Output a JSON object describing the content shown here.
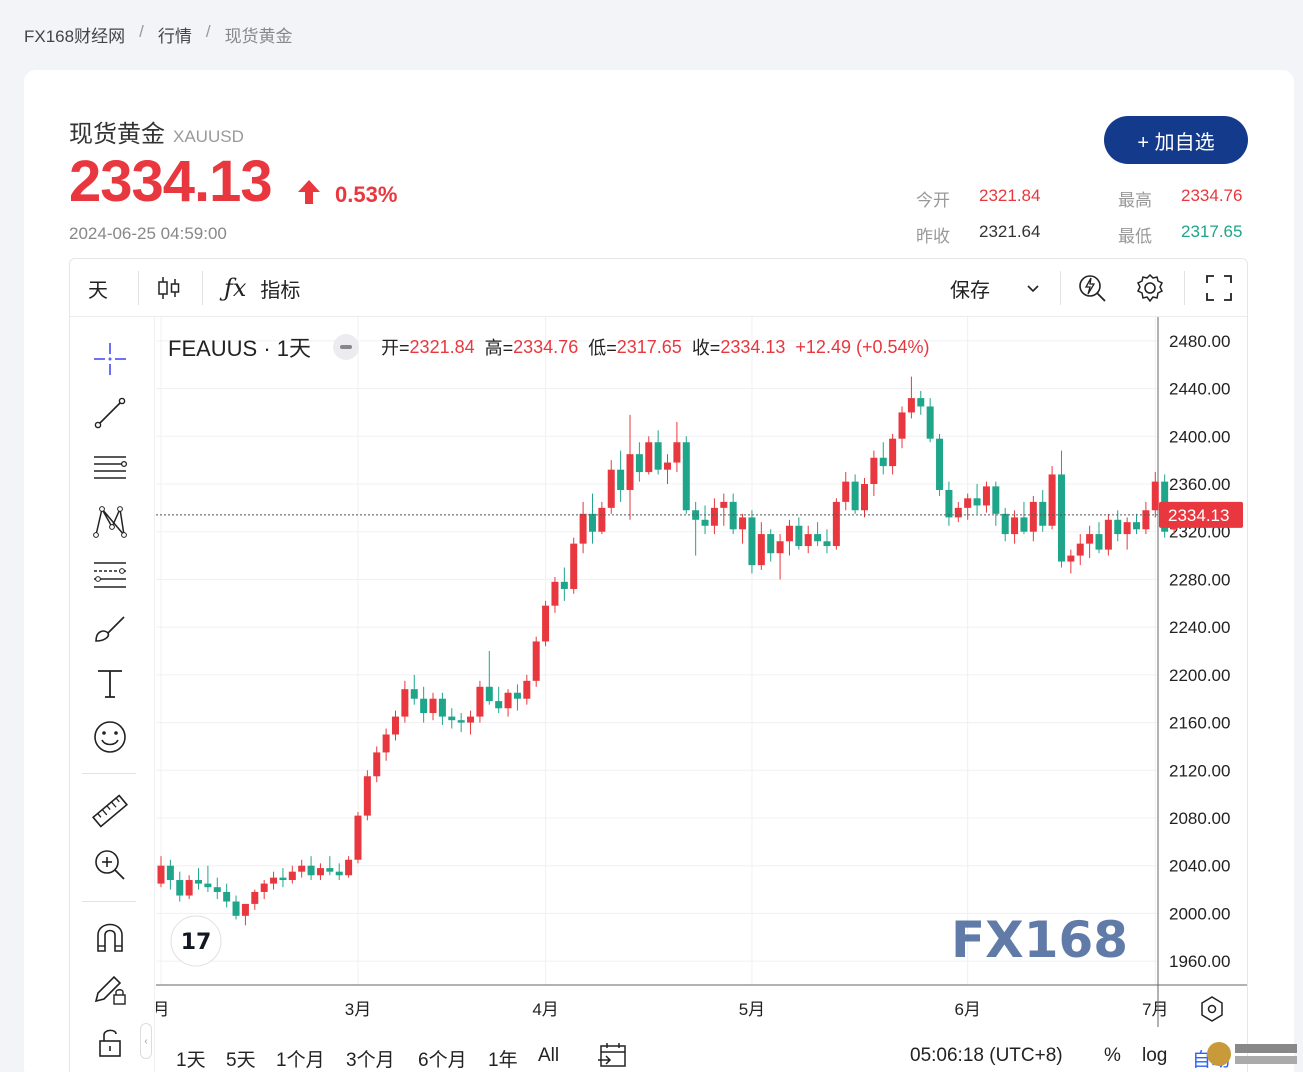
{
  "breadcrumb": {
    "home": "FX168财经网",
    "sep": "/",
    "section": "行情",
    "current": "现货黄金"
  },
  "quote": {
    "title": "现货黄金",
    "code": "XAUUSD",
    "price": "2334.13",
    "change_pct": "0.53%",
    "timestamp": "2024-06-25 04:59:00",
    "add_button": "+ 加自选"
  },
  "stats": {
    "open_label": "今开",
    "open": "2321.84",
    "prev_label": "昨收",
    "prev": "2321.64",
    "high_label": "最高",
    "high": "2334.76",
    "low_label": "最低",
    "low": "2317.65"
  },
  "toolbar": {
    "interval": "天",
    "indicators": "指标",
    "save": "保存"
  },
  "legend": {
    "symbol": "FEAUUS · 1天",
    "open_k": "开=",
    "open_v": "2321.84",
    "high_k": "高=",
    "high_v": "2334.76",
    "low_k": "低=",
    "low_v": "2317.65",
    "close_k": "收=",
    "close_v": "2334.13",
    "change": "+12.49 (+0.54%)"
  },
  "bottom": {
    "ranges": [
      "1天",
      "5天",
      "1个月",
      "3个月",
      "6个月",
      "1年",
      "All"
    ],
    "clock": "05:06:18 (UTC+8)",
    "pct": "%",
    "log": "log",
    "auto": "自动"
  },
  "watermark": {
    "brand": "FX168"
  },
  "colors": {
    "up": "#e8373e",
    "down": "#1fa58a",
    "brand": "#143a8c"
  },
  "chart_data": {
    "type": "candlestick",
    "y_ticks": [
      "2480.00",
      "2440.00",
      "2400.00",
      "2360.00",
      "2320.00",
      "2280.00",
      "2240.00",
      "2200.00",
      "2160.00",
      "2120.00",
      "2080.00",
      "2040.00",
      "2000.00",
      "1960.00"
    ],
    "ylim": [
      1940,
      2500
    ],
    "x_ticks": [
      {
        "label": "月",
        "idx": 0
      },
      {
        "label": "3月",
        "idx": 21
      },
      {
        "label": "4月",
        "idx": 41
      },
      {
        "label": "5月",
        "idx": 63
      },
      {
        "label": "6月",
        "idx": 86
      },
      {
        "label": "7月",
        "idx": 106
      }
    ],
    "last_price": "2334.13",
    "ohlc": [
      [
        2025,
        2048,
        2022,
        2040
      ],
      [
        2040,
        2045,
        2020,
        2028
      ],
      [
        2028,
        2035,
        2010,
        2015
      ],
      [
        2015,
        2032,
        2012,
        2028
      ],
      [
        2028,
        2038,
        2020,
        2025
      ],
      [
        2025,
        2040,
        2018,
        2022
      ],
      [
        2022,
        2030,
        2012,
        2018
      ],
      [
        2018,
        2025,
        2005,
        2010
      ],
      [
        2010,
        2015,
        1995,
        1998
      ],
      [
        1998,
        2008,
        1990,
        2008
      ],
      [
        2008,
        2020,
        2003,
        2018
      ],
      [
        2018,
        2028,
        2012,
        2025
      ],
      [
        2025,
        2035,
        2020,
        2030
      ],
      [
        2030,
        2038,
        2022,
        2028
      ],
      [
        2028,
        2040,
        2025,
        2035
      ],
      [
        2035,
        2045,
        2030,
        2040
      ],
      [
        2040,
        2048,
        2028,
        2032
      ],
      [
        2032,
        2042,
        2028,
        2038
      ],
      [
        2038,
        2048,
        2032,
        2035
      ],
      [
        2035,
        2042,
        2028,
        2032
      ],
      [
        2032,
        2048,
        2030,
        2045
      ],
      [
        2045,
        2085,
        2042,
        2082
      ],
      [
        2082,
        2120,
        2078,
        2115
      ],
      [
        2115,
        2140,
        2110,
        2135
      ],
      [
        2135,
        2155,
        2128,
        2150
      ],
      [
        2150,
        2170,
        2145,
        2165
      ],
      [
        2165,
        2195,
        2160,
        2188
      ],
      [
        2188,
        2200,
        2175,
        2180
      ],
      [
        2180,
        2190,
        2160,
        2168
      ],
      [
        2168,
        2185,
        2162,
        2180
      ],
      [
        2180,
        2185,
        2158,
        2165
      ],
      [
        2165,
        2172,
        2155,
        2162
      ],
      [
        2162,
        2168,
        2152,
        2160
      ],
      [
        2160,
        2170,
        2150,
        2165
      ],
      [
        2165,
        2195,
        2160,
        2190
      ],
      [
        2190,
        2220,
        2175,
        2178
      ],
      [
        2178,
        2190,
        2168,
        2172
      ],
      [
        2172,
        2188,
        2165,
        2185
      ],
      [
        2185,
        2192,
        2170,
        2180
      ],
      [
        2180,
        2200,
        2175,
        2195
      ],
      [
        2195,
        2232,
        2190,
        2228
      ],
      [
        2228,
        2262,
        2224,
        2258
      ],
      [
        2258,
        2282,
        2252,
        2278
      ],
      [
        2278,
        2290,
        2262,
        2272
      ],
      [
        2272,
        2315,
        2268,
        2310
      ],
      [
        2310,
        2345,
        2302,
        2335
      ],
      [
        2335,
        2352,
        2310,
        2320
      ],
      [
        2320,
        2345,
        2318,
        2340
      ],
      [
        2340,
        2380,
        2335,
        2372
      ],
      [
        2372,
        2388,
        2345,
        2355
      ],
      [
        2355,
        2418,
        2330,
        2385
      ],
      [
        2385,
        2395,
        2362,
        2370
      ],
      [
        2370,
        2400,
        2368,
        2395
      ],
      [
        2395,
        2405,
        2368,
        2372
      ],
      [
        2372,
        2385,
        2360,
        2378
      ],
      [
        2378,
        2412,
        2370,
        2395
      ],
      [
        2395,
        2400,
        2335,
        2338
      ],
      [
        2338,
        2345,
        2300,
        2330
      ],
      [
        2330,
        2342,
        2318,
        2325
      ],
      [
        2325,
        2348,
        2318,
        2340
      ],
      [
        2340,
        2352,
        2325,
        2345
      ],
      [
        2345,
        2352,
        2318,
        2322
      ],
      [
        2322,
        2335,
        2310,
        2332
      ],
      [
        2332,
        2338,
        2285,
        2292
      ],
      [
        2292,
        2328,
        2288,
        2318
      ],
      [
        2318,
        2322,
        2295,
        2302
      ],
      [
        2302,
        2318,
        2280,
        2312
      ],
      [
        2312,
        2330,
        2300,
        2325
      ],
      [
        2325,
        2332,
        2305,
        2308
      ],
      [
        2308,
        2325,
        2302,
        2318
      ],
      [
        2318,
        2328,
        2308,
        2312
      ],
      [
        2312,
        2322,
        2302,
        2308
      ],
      [
        2308,
        2348,
        2305,
        2345
      ],
      [
        2345,
        2370,
        2338,
        2362
      ],
      [
        2362,
        2368,
        2335,
        2338
      ],
      [
        2338,
        2365,
        2332,
        2360
      ],
      [
        2360,
        2388,
        2350,
        2382
      ],
      [
        2382,
        2395,
        2368,
        2375
      ],
      [
        2375,
        2402,
        2368,
        2398
      ],
      [
        2398,
        2425,
        2390,
        2420
      ],
      [
        2420,
        2450,
        2415,
        2432
      ],
      [
        2432,
        2438,
        2418,
        2425
      ],
      [
        2425,
        2432,
        2395,
        2398
      ],
      [
        2398,
        2402,
        2350,
        2355
      ],
      [
        2355,
        2362,
        2325,
        2332
      ],
      [
        2332,
        2345,
        2328,
        2340
      ],
      [
        2340,
        2352,
        2330,
        2348
      ],
      [
        2348,
        2360,
        2335,
        2342
      ],
      [
        2342,
        2362,
        2336,
        2358
      ],
      [
        2358,
        2362,
        2325,
        2335
      ],
      [
        2335,
        2340,
        2312,
        2318
      ],
      [
        2318,
        2338,
        2310,
        2332
      ],
      [
        2332,
        2345,
        2318,
        2320
      ],
      [
        2320,
        2350,
        2312,
        2345
      ],
      [
        2345,
        2355,
        2320,
        2325
      ],
      [
        2325,
        2375,
        2322,
        2368
      ],
      [
        2368,
        2388,
        2290,
        2295
      ],
      [
        2295,
        2305,
        2285,
        2300
      ],
      [
        2300,
        2318,
        2292,
        2310
      ],
      [
        2310,
        2325,
        2298,
        2318
      ],
      [
        2318,
        2328,
        2302,
        2305
      ],
      [
        2305,
        2335,
        2300,
        2330
      ],
      [
        2330,
        2338,
        2312,
        2318
      ],
      [
        2318,
        2332,
        2305,
        2328
      ],
      [
        2328,
        2335,
        2318,
        2322
      ],
      [
        2322,
        2345,
        2318,
        2338
      ],
      [
        2338,
        2370,
        2332,
        2362
      ],
      [
        2362,
        2368,
        2315,
        2320
      ],
      [
        2321.84,
        2334.76,
        2317.65,
        2334.13
      ]
    ]
  }
}
